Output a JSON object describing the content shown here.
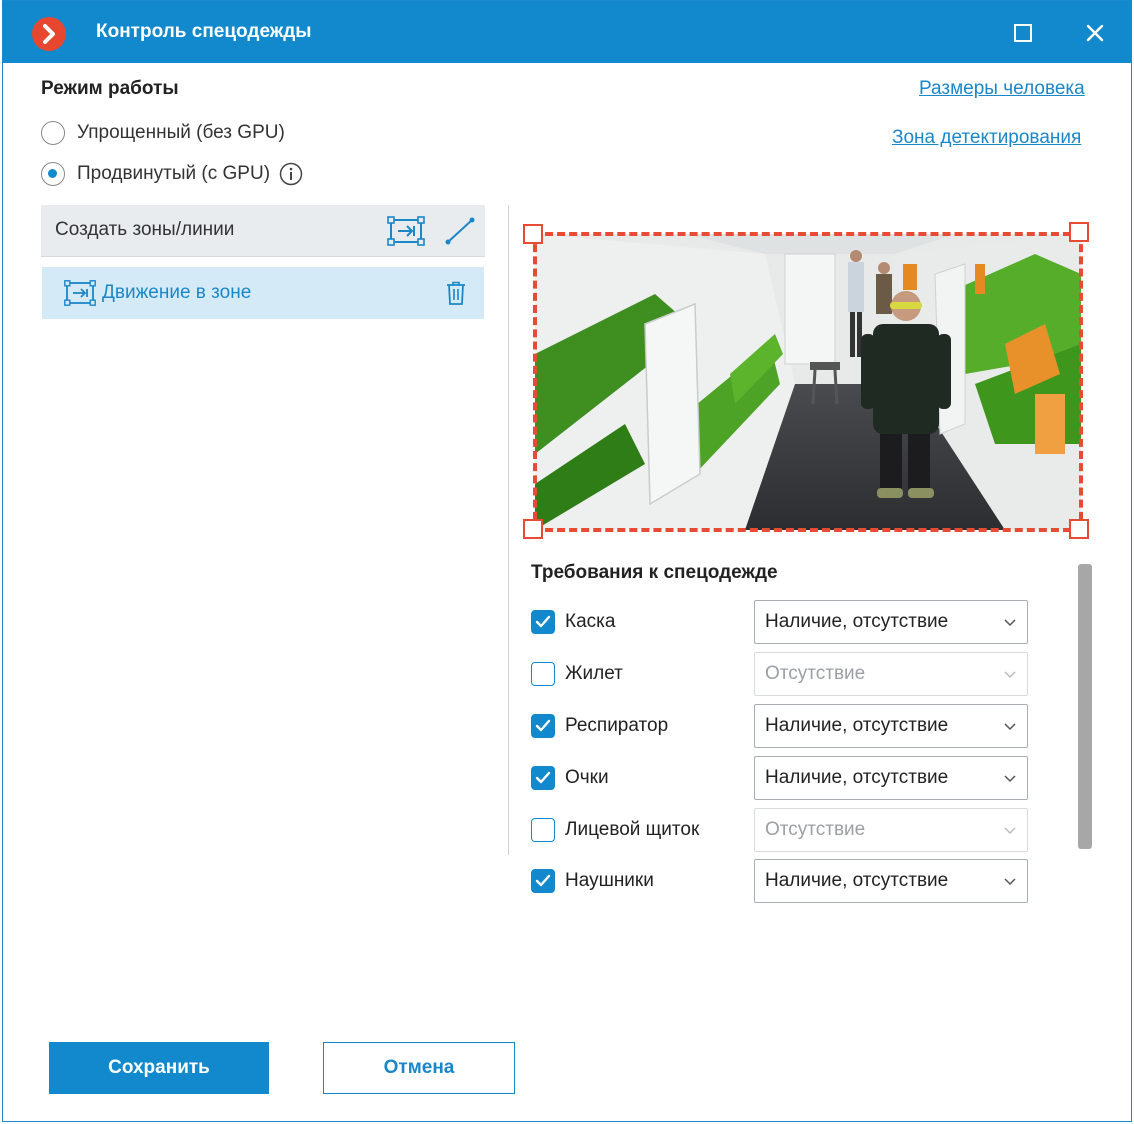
{
  "window": {
    "title": "Контроль спецодежды",
    "accent_color": "#1189cc",
    "logo_icon": "chevron-right-icon"
  },
  "mode": {
    "title": "Режим работы",
    "options": [
      {
        "label": "Упрощенный (без GPU)",
        "selected": false
      },
      {
        "label": "Продвинутый (с GPU)",
        "selected": true,
        "icon": "info-icon"
      }
    ]
  },
  "links": {
    "person_size": "Размеры человека",
    "detection_zone": "Зона детектирования"
  },
  "zones": {
    "header_label": "Создать зоны/линии",
    "items": [
      {
        "label": "Движение в зоне",
        "icon": "zone-icon",
        "action_icon": "trash-icon"
      }
    ]
  },
  "requirements": {
    "title": "Требования к спецодежде",
    "items": [
      {
        "label": "Каска",
        "checked": true,
        "value": "Наличие, отсутствие",
        "enabled": true
      },
      {
        "label": "Жилет",
        "checked": false,
        "value": "Отсутствие",
        "enabled": false
      },
      {
        "label": "Респиратор",
        "checked": true,
        "value": "Наличие, отсутствие",
        "enabled": true
      },
      {
        "label": "Очки",
        "checked": true,
        "value": "Наличие, отсутствие",
        "enabled": true
      },
      {
        "label": "Лицевой щиток",
        "checked": false,
        "value": "Отсутствие",
        "enabled": false
      },
      {
        "label": "Наушники",
        "checked": true,
        "value": "Наличие, отсутствие",
        "enabled": true
      }
    ]
  },
  "buttons": {
    "save": "Сохранить",
    "cancel": "Отмена"
  },
  "colors": {
    "zone_border": "#e84b33",
    "selected_row": "#d4ebf7"
  }
}
